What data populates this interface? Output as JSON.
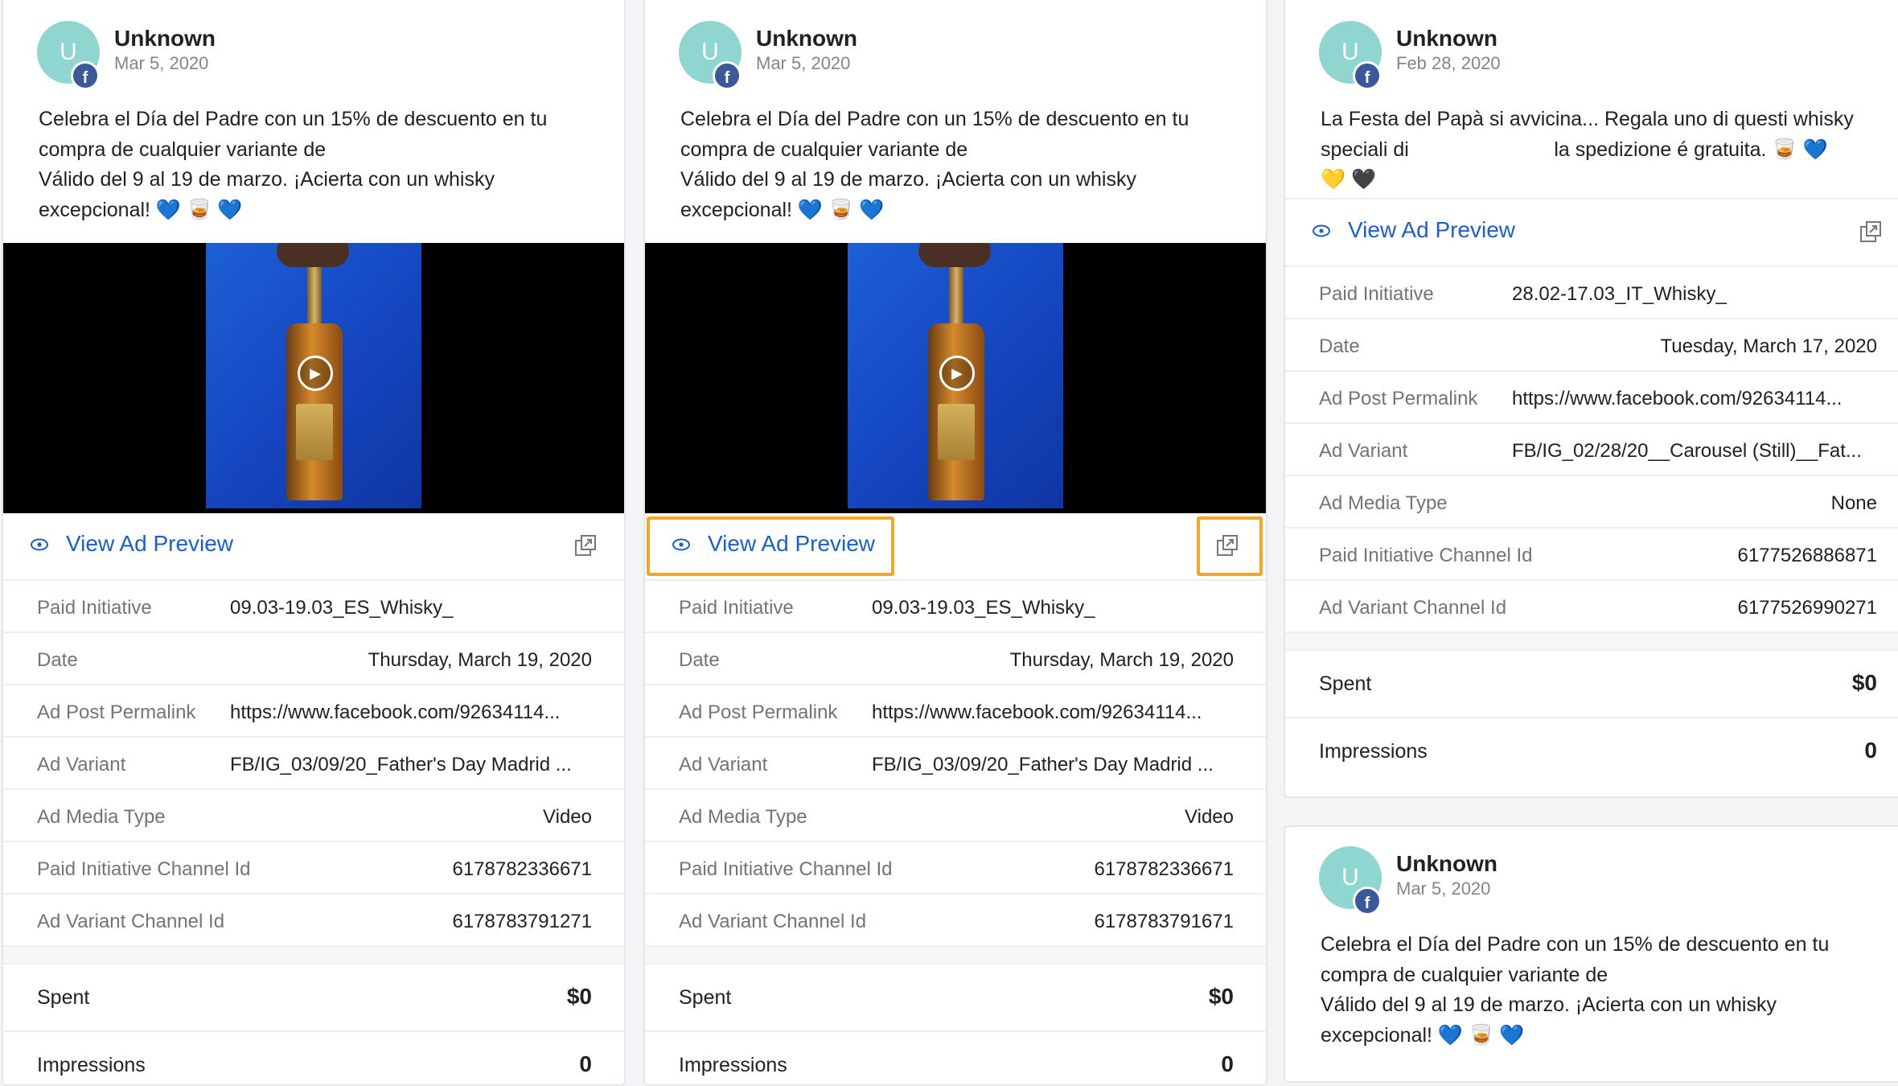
{
  "colors": {
    "link": "#1a5fd1",
    "highlight": "#f5a623",
    "avatar": "#8ed6cf",
    "facebook": "#3b5998"
  },
  "labels": {
    "view_ad_preview": "View Ad Preview",
    "paid_initiative": "Paid Initiative",
    "date": "Date",
    "ad_post_permalink": "Ad Post Permalink",
    "ad_variant": "Ad Variant",
    "ad_media_type": "Ad Media Type",
    "paid_initiative_channel_id": "Paid Initiative Channel Id",
    "ad_variant_channel_id": "Ad Variant Channel Id",
    "spent": "Spent",
    "impressions": "Impressions"
  },
  "cards": [
    {
      "author": "Unknown",
      "avatar_letter": "U",
      "date": "Mar 5, 2020",
      "post_text": "Celebra el Día del Padre con un 15% de descuento en tu\ncompra de cualquier variante de\nVálido del 9 al 19 de marzo. ¡Acierta con un whisky\nexcepcional! 💙 🥃 💙",
      "paid_initiative": "09.03-19.03_ES_Whisky_",
      "date_value": "Thursday, March 19, 2020",
      "permalink": "https://www.facebook.com/92634114...",
      "ad_variant": "FB/IG_03/09/20_Father's Day Madrid ...",
      "media_type": "Video",
      "paid_initiative_channel_id": "6178782336671",
      "ad_variant_channel_id": "6178783791271",
      "spent": "$0",
      "impressions": "0"
    },
    {
      "author": "Unknown",
      "avatar_letter": "U",
      "date": "Mar 5, 2020",
      "post_text": "Celebra el Día del Padre con un 15% de descuento en tu\ncompra de cualquier variante de\nVálido del 9 al 19 de marzo. ¡Acierta con un whisky\nexcepcional! 💙 🥃 💙",
      "paid_initiative": "09.03-19.03_ES_Whisky_",
      "date_value": "Thursday, March 19, 2020",
      "permalink": "https://www.facebook.com/92634114...",
      "ad_variant": "FB/IG_03/09/20_Father's Day Madrid ...",
      "media_type": "Video",
      "paid_initiative_channel_id": "6178782336671",
      "ad_variant_channel_id": "6178783791671",
      "spent": "$0",
      "impressions": "0"
    },
    {
      "author": "Unknown",
      "avatar_letter": "U",
      "date": "Feb 28, 2020",
      "post_text": "La Festa del Papà si avvicina... Regala uno di questi whisky\nspeciali di                          la spedizione é gratuita. 🥃 💙\n💛 🖤",
      "paid_initiative": "28.02-17.03_IT_Whisky_",
      "date_value": "Tuesday, March 17, 2020",
      "permalink": "https://www.facebook.com/92634114...",
      "ad_variant": "FB/IG_02/28/20__Carousel (Still)__Fat...",
      "media_type": "None",
      "paid_initiative_channel_id": "6177526886871",
      "ad_variant_channel_id": "6177526990271",
      "spent": "$0",
      "impressions": "0"
    },
    {
      "author": "Unknown",
      "avatar_letter": "U",
      "date": "Mar 5, 2020",
      "post_text": "Celebra el Día del Padre con un 15% de descuento en tu\ncompra de cualquier variante de\nVálido del 9 al 19 de marzo. ¡Acierta con un whisky\nexcepcional! 💙 🥃 💙"
    }
  ]
}
